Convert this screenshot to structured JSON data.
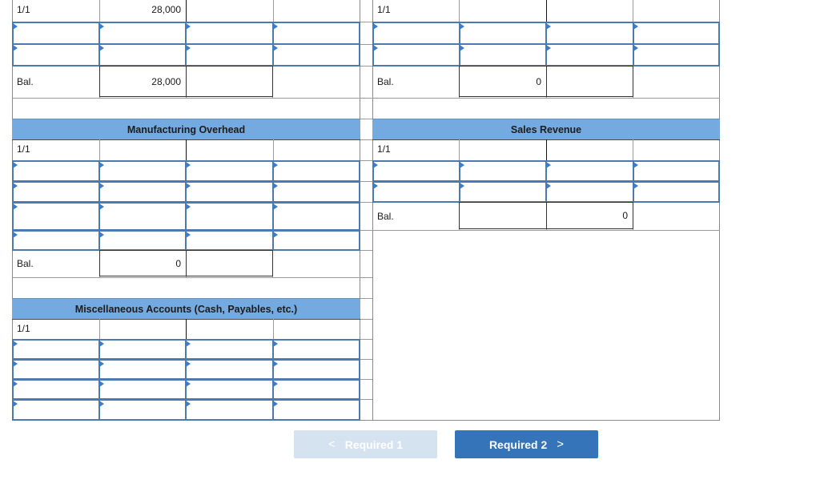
{
  "colors": {
    "header_bg": "#74aae0",
    "input_border": "#4a7ab0",
    "input_marker": "#3d7cc9",
    "next_button_bg": "#3574b8",
    "prev_button_bg": "#d5e2ef"
  },
  "accounts": {
    "top_left": {
      "opening_label": "1/1",
      "opening_debit": "28,000",
      "balance_label": "Bal.",
      "balance_debit": "28,000",
      "balance_credit": ""
    },
    "top_right": {
      "opening_label": "1/1",
      "opening_debit": "",
      "balance_label": "Bal.",
      "balance_debit": "0",
      "balance_credit": ""
    },
    "manufacturing_overhead": {
      "title": "Manufacturing Overhead",
      "opening_label": "1/1",
      "balance_label": "Bal.",
      "balance_debit": "0",
      "balance_credit": ""
    },
    "sales_revenue": {
      "title": "Sales Revenue",
      "opening_label": "1/1",
      "balance_label": "Bal.",
      "balance_debit": "",
      "balance_credit": "0"
    },
    "miscellaneous": {
      "title": "Miscellaneous Accounts (Cash, Payables, etc.)",
      "opening_label": "1/1"
    }
  },
  "navigation": {
    "prev_label": "Required 1",
    "prev_icon": "chevron-left-icon",
    "prev_chevron": "<",
    "next_label": "Required 2",
    "next_icon": "chevron-right-icon",
    "next_chevron": ">"
  }
}
